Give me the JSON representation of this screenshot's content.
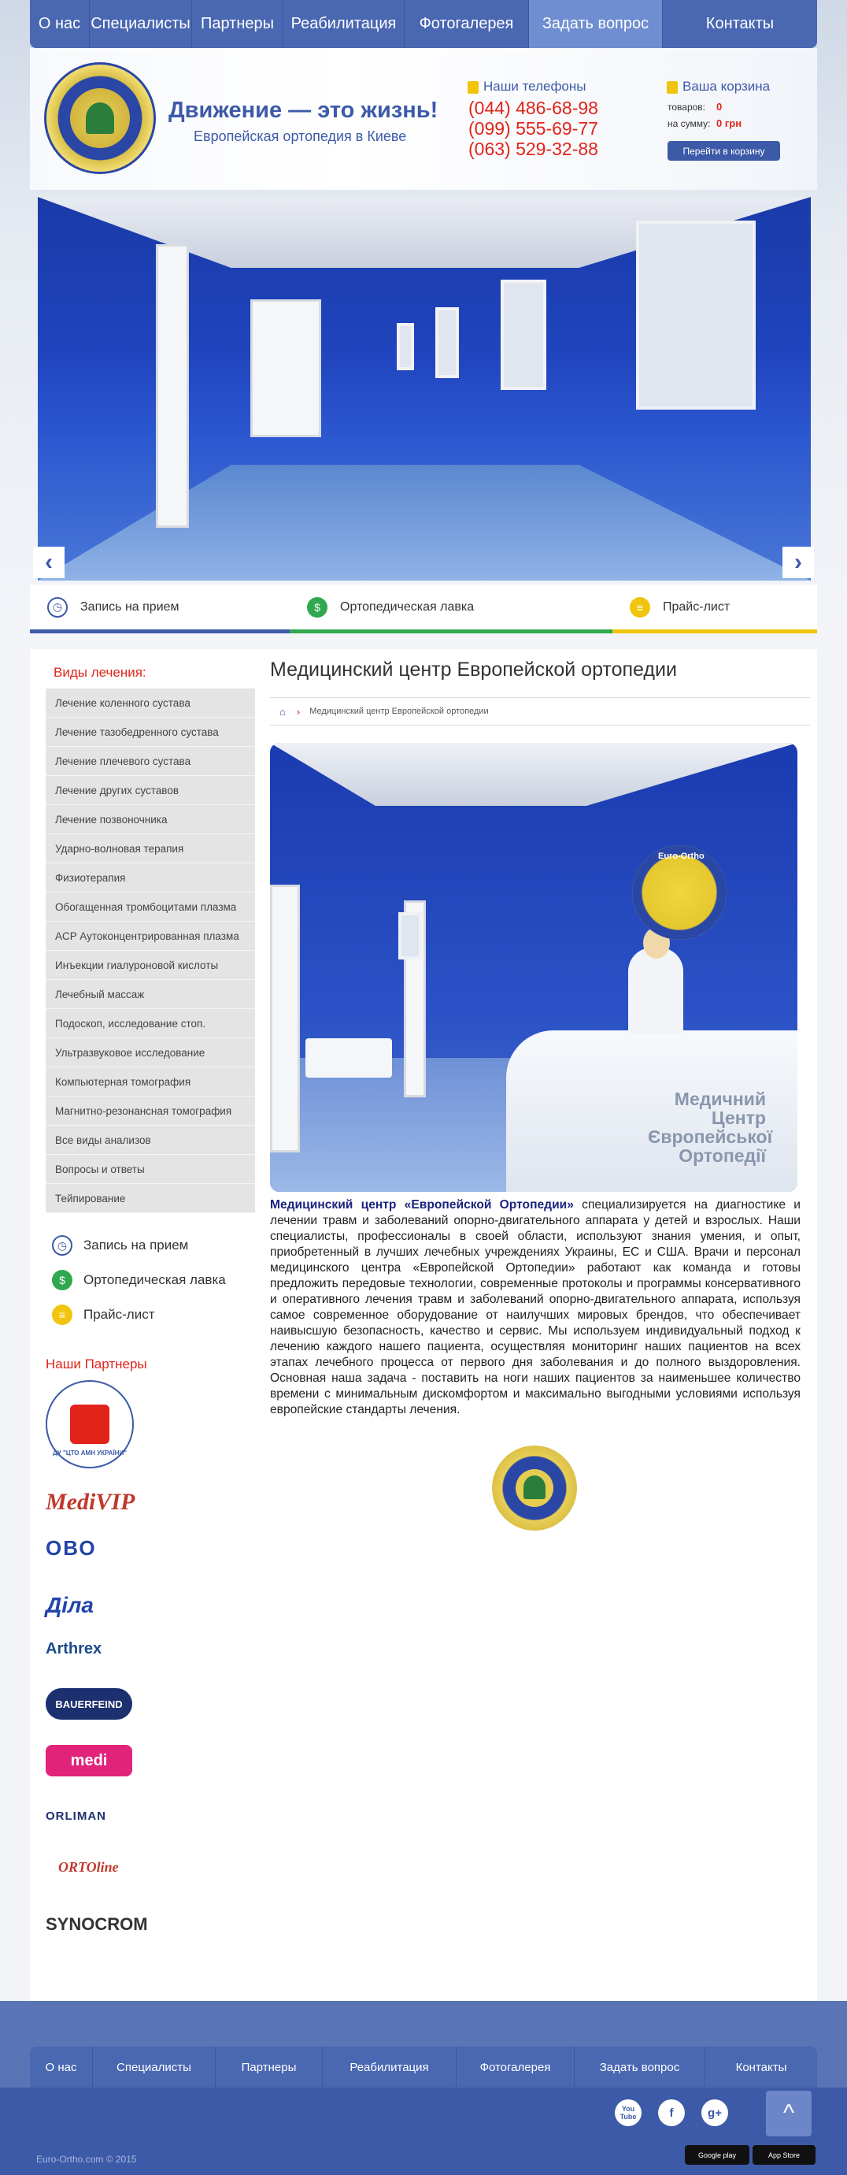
{
  "topnav": [
    "О нас",
    "Специалисты",
    "Партнеры",
    "Реабилитация",
    "Фотогалерея",
    "Задать вопрос",
    "Контакты"
  ],
  "header": {
    "slogan": "Движение — это жизнь!",
    "subslogan": "Европейская ортопедия в Киеве",
    "phones_title": "Наши телефоны",
    "phones": [
      "(044) 486-68-98",
      "(099) 555-69-77",
      "(063) 529-32-88"
    ],
    "cart_title": "Ваша корзина",
    "cart_items_label": "товаров:",
    "cart_items_value": "0",
    "cart_sum_label": "на сумму:",
    "cart_sum_value": "0 грн",
    "cart_button": "Перейти в корзину"
  },
  "slider": {
    "prev": "‹",
    "next": "›"
  },
  "quick_tabs": [
    {
      "label": "Запись на прием",
      "color": "#3d5aa8",
      "icon": "clock-24-icon"
    },
    {
      "label": "Ортопедическая лавка",
      "color": "#2fa84f",
      "icon": "cart-icon"
    },
    {
      "label": "Прайс-лист",
      "color": "#f1c40f",
      "icon": "list-icon"
    }
  ],
  "sidebar": {
    "title": "Виды лечения:",
    "items": [
      "Лечение коленного сустава",
      "Лечение тазобедренного сустава",
      "Лечение плечевого сустава",
      "Лечение других суставов",
      "Лечение позвоночника",
      "Ударно-волновая терапия",
      "Физиотерапия",
      "Обогащенная тромбоцитами плазма",
      "ACP Аутоконцентрированная плазма",
      "Инъекции гиалуроновой кислоты",
      "Лечебный массаж",
      "Подоскоп, исследование стоп.",
      "Ультразвуковое исследование",
      "Компьютерная томография",
      "Магнитно-резонансная томография",
      "Все виды анализов",
      "Вопросы и ответы",
      "Тейпирование"
    ],
    "links": [
      "Запись на прием",
      "Ортопедическая лавка",
      "Прайс-лист"
    ],
    "partners_title": "Наши Партнеры",
    "partners": [
      "ДУ \"ЦТО АМН УКРАЇНИ\"",
      "MediVIP",
      "ОВО",
      "Діла",
      "Arthrex",
      "BAUERFEIND",
      "medi",
      "ORLIMAN",
      "ORTOline",
      "SYNOCROM"
    ]
  },
  "content": {
    "title": "Медицинский центр Европейской ортопедии",
    "breadcrumb": "Медицинский центр Европейской ортопедии",
    "photo_caption": "Медичний Центр Європейської Ортопедії",
    "logo_text": "Euro-Ortho",
    "lead": "Медицинский центр «Европейской Ортопедии»",
    "body": "специализируется на диагностике и лечении травм и заболеваний опорно-двигательного аппарата у детей и взрослых. Наши специалисты, профессионалы в своей области, используют знания умения, и опыт, приобретенный в лучших лечебных учреждениях Украины, ЕС и США. Врачи и персонал медицинского центра «Европейской Ортопедии» работают как команда и готовы предложить передовые технологии, современные протоколы и программы консервативного и оперативного лечения травм и заболеваний опорно-двигательного аппарата, используя самое современное оборудование от наилучших мировых брендов, что обеспечивает наивысшую безопасность, качество и сервис. Мы используем индивидуальный подход к лечению каждого нашего пациента, осуществляя мониторинг наших пациентов на всех этапах лечебного процесса от первого дня заболевания и до полного выздоровления. Основная наша задача - поставить на ноги наших пациентов за наименьшее количество времени с минимальным дискомфортом и максимально выгодными условиями используя европейские стандарты лечения."
  },
  "footer": {
    "nav": [
      "О нас",
      "Специалисты",
      "Партнеры",
      "Реабилитация",
      "Фотогалерея",
      "Задать вопрос",
      "Контакты"
    ],
    "copyright": "Euro-Ortho.com © 2015",
    "google_play": "Google play",
    "app_store": "App Store",
    "social": [
      "You Tube",
      "f",
      "g+"
    ],
    "totop": "^"
  }
}
